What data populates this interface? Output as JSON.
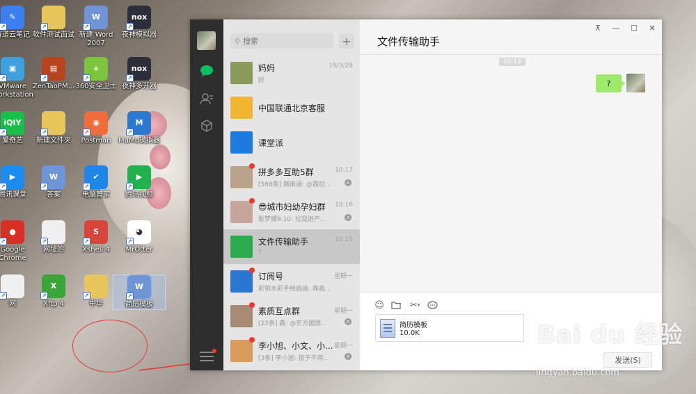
{
  "desktop": {
    "icons": [
      {
        "label": "有道云笔记",
        "color": "#3d7ef0",
        "glyph": "✎"
      },
      {
        "label": "软件测试面试",
        "color": "#e8c65a",
        "glyph": ""
      },
      {
        "label": "新建 Word 2007",
        "color": "#6f95d6",
        "glyph": "W"
      },
      {
        "label": "夜神模拟器",
        "color": "#2c2f3a",
        "glyph": "nox"
      },
      {
        "label": "VMware Workstation",
        "color": "#3ea0de",
        "glyph": "▣"
      },
      {
        "label": "ZenTaoPM...",
        "color": "#b8431f",
        "glyph": "▤"
      },
      {
        "label": "360安全卫士",
        "color": "#7ac53b",
        "glyph": "+"
      },
      {
        "label": "夜神多开器",
        "color": "#2c2f3a",
        "glyph": "nox"
      },
      {
        "label": "爱奇艺",
        "color": "#18c04a",
        "glyph": "iQIY"
      },
      {
        "label": "新建文件夹",
        "color": "#e8c65a",
        "glyph": ""
      },
      {
        "label": "Postman",
        "color": "#f26b3a",
        "glyph": "◉"
      },
      {
        "label": "MuMu模拟器",
        "color": "#2b79d0",
        "glyph": "M"
      },
      {
        "label": "腾讯课堂",
        "color": "#1d8cf0",
        "glyph": "▶"
      },
      {
        "label": "答案",
        "color": "#6f95d6",
        "glyph": "W"
      },
      {
        "label": "电脑管家",
        "color": "#1e86e8",
        "glyph": "✔"
      },
      {
        "label": "腾讯视频",
        "color": "#22b14c",
        "glyph": "▶"
      },
      {
        "label": "Google Chrome",
        "color": "#d93025",
        "glyph": "●"
      },
      {
        "label": "网址的",
        "color": "#f0f0f0",
        "glyph": ""
      },
      {
        "label": "Xshell 4",
        "color": "#d9453a",
        "glyph": "S"
      },
      {
        "label": "MrOtter",
        "color": "#ffffff",
        "glyph": "◕"
      },
      {
        "label": "网",
        "color": "#f0f0f0",
        "glyph": ""
      },
      {
        "label": "Xftp 4",
        "color": "#3aa63a",
        "glyph": "X"
      },
      {
        "label": "中华",
        "color": "#e8c65a",
        "glyph": ""
      },
      {
        "label": "简历模板",
        "color": "#6f95d6",
        "glyph": "W"
      }
    ]
  },
  "wechat": {
    "search_placeholder": "搜索",
    "add_label": "+",
    "chats": [
      {
        "name": "妈妈",
        "time": "19/3/28",
        "preview": "好",
        "muted": false,
        "unread": false,
        "avatar": "#8a9a5b"
      },
      {
        "name": "中国联通北京客服",
        "time": "",
        "preview": "",
        "muted": false,
        "unread": false,
        "avatar": "#f2b632"
      },
      {
        "name": "课堂派",
        "time": "",
        "preview": "",
        "muted": false,
        "unread": false,
        "avatar": "#1f7ae0"
      },
      {
        "name": "拼多多互助5群",
        "time": "10:17",
        "preview": "[568条] 魏雨涵: @霞拉...",
        "muted": true,
        "unread": true,
        "avatar": "#b9a48a"
      },
      {
        "name": "😎城市妇幼孕妇群",
        "time": "10:16",
        "preview": "耿梦娜9.10: 拉我进产...",
        "muted": true,
        "unread": true,
        "avatar": "#c7a59a"
      },
      {
        "name": "文件传输助手",
        "time": "10:15",
        "preview": "?",
        "muted": false,
        "unread": false,
        "avatar": "#2bab4c"
      },
      {
        "name": "订阅号",
        "time": "星期一",
        "preview": "彩铂水彩手绘画画: 靠画...",
        "muted": false,
        "unread": true,
        "avatar": "#2b76d2"
      },
      {
        "name": "素质互点群",
        "time": "星期一",
        "preview": "[22条] 鑫: @东方国旅...",
        "muted": true,
        "unread": true,
        "avatar": "#a68a73"
      },
      {
        "name": "李小旭、小文、小...",
        "time": "星期一",
        "preview": "[3条] 李小旭: 孩子不用...",
        "muted": true,
        "unread": true,
        "avatar": "#d99c5a"
      }
    ],
    "active_chat_title": "文件传输助手",
    "window_controls": [
      "⊼",
      "—",
      "☐",
      "✕"
    ],
    "message_time": "10:15",
    "message_text": "?",
    "file": {
      "name": "简历模板",
      "size": "10.0K"
    },
    "send_label": "发送(S)",
    "toolbar_icons": [
      "emoji-icon",
      "folder-icon",
      "scissors-icon",
      "chat-icon"
    ]
  },
  "watermark": {
    "brand": "Bai du 经验",
    "url": "jingyan.baidu.com"
  },
  "colors": {
    "wechat_green": "#07c160",
    "bubble_green": "#9eea6a",
    "badge_red": "#f43530",
    "annotation_red": "#e53935"
  }
}
